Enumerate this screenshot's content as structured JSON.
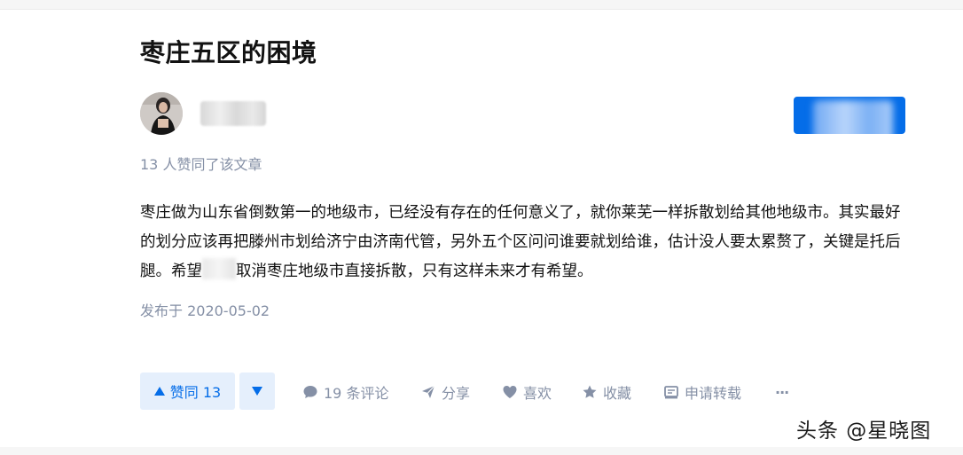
{
  "article": {
    "title": "枣庄五区的困境",
    "upvote_summary": "13 人赞同了该文章",
    "content_part1": "枣庄做为山东省倒数第一的地级市，已经没有存在的任何意义了，就你莱芜一样拆散划给其他地级市。其实最好的划分应该再把滕州市划给济宁由济南代管，另外五个区问问谁要就划给谁，估计没人要太累赘了，关键是托后腿。希望",
    "content_part2": "取消枣庄地级市直接拆散，只有这样未来才有希望。",
    "published": "发布于 2020-05-02"
  },
  "actions": {
    "upvote_label": "赞同 13",
    "comments_label": "19 条评论",
    "share_label": "分享",
    "like_label": "喜欢",
    "collect_label": "收藏",
    "repost_label": "申请转载",
    "more_label": "···"
  },
  "watermark": "头条 @星晓图",
  "colors": {
    "accent": "#056de8",
    "accent_bg": "#e5effc",
    "meta_gray": "#8590a6"
  },
  "icons": [
    "avatar",
    "triangle-up-icon",
    "triangle-down-icon",
    "comment-icon",
    "share-icon",
    "heart-icon",
    "star-icon",
    "repost-icon",
    "more-icon"
  ]
}
